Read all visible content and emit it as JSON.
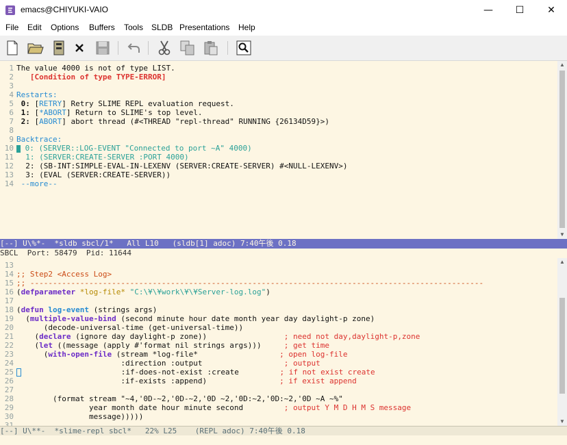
{
  "window": {
    "title": "emacs@CHIYUKI-VAIO"
  },
  "menu": [
    "File",
    "Edit",
    "Options",
    "Buffers",
    "Tools",
    "SLDB",
    "Presentations",
    "Help"
  ],
  "toolbar": {
    "icons": [
      "new-file-icon",
      "open-folder-icon",
      "dired-icon",
      "close-buffer-icon",
      "save-icon",
      "undo-icon",
      "cut-icon",
      "copy-icon",
      "paste-icon",
      "search-icon"
    ]
  },
  "sldb": {
    "lines": [
      {
        "n": "1",
        "segs": [
          [
            "",
            "The value 4000 is not of type LIST."
          ]
        ]
      },
      {
        "n": "2",
        "segs": [
          [
            "err",
            "   [Condition of type TYPE-ERROR]"
          ]
        ]
      },
      {
        "n": "3",
        "segs": [
          [
            "",
            ""
          ]
        ]
      },
      {
        "n": "4",
        "segs": [
          [
            "lbl",
            "Restarts:"
          ]
        ]
      },
      {
        "n": "5",
        "segs": [
          [
            "",
            ""
          ],
          [
            "kw0",
            " 0: "
          ],
          [
            "",
            "["
          ],
          [
            "lbl",
            "RETRY"
          ],
          [
            "",
            "] Retry SLIME REPL evaluation request."
          ]
        ]
      },
      {
        "n": "6",
        "segs": [
          [
            "kw0",
            " 1: "
          ],
          [
            "",
            "["
          ],
          [
            "lbl",
            "*ABORT"
          ],
          [
            "",
            "] Return to SLIME's top level."
          ]
        ]
      },
      {
        "n": "7",
        "segs": [
          [
            "kw0",
            " 2: "
          ],
          [
            "",
            "["
          ],
          [
            "lbl",
            "ABORT"
          ],
          [
            "",
            "] abort thread (#<THREAD \"repl-thread\" RUNNING {26134D59}>)"
          ]
        ]
      },
      {
        "n": "8",
        "segs": [
          [
            "",
            ""
          ]
        ]
      },
      {
        "n": "9",
        "segs": [
          [
            "lbl",
            "Backtrace:"
          ]
        ]
      },
      {
        "n": "10",
        "segs": [
          [
            "cursor",
            ""
          ],
          [
            "grn",
            " 0: (SERVER::LOG-EVENT \"Connected to port ~A\" 4000)"
          ]
        ]
      },
      {
        "n": "11",
        "segs": [
          [
            "grn",
            "  1: (SERVER:CREATE-SERVER :PORT 4000)"
          ]
        ]
      },
      {
        "n": "12",
        "segs": [
          [
            "",
            "  2: (SB-INT:SIMPLE-EVAL-IN-LEXENV (SERVER:CREATE-SERVER) #<NULL-LEXENV>)"
          ]
        ]
      },
      {
        "n": "13",
        "segs": [
          [
            "",
            "  3: (EVAL (SERVER:CREATE-SERVER))"
          ]
        ]
      },
      {
        "n": "14",
        "segs": [
          [
            "lbl",
            " --more--"
          ]
        ]
      }
    ],
    "modeline": "[--] U\\%*-  *sldb sbcl/1*   All L10   (sldb[1] adoc) 7:40午後 0.18"
  },
  "echo": "SBCL  Port: 58479  Pid: 11644",
  "repl": {
    "lines": [
      {
        "n": "13",
        "segs": [
          [
            "",
            ""
          ]
        ]
      },
      {
        "n": "14",
        "segs": [
          [
            "cmt",
            ";; Step2 <Access Log>"
          ]
        ]
      },
      {
        "n": "15",
        "segs": [
          [
            "cmt",
            ";; ----------------------------------------------------------------------------------------------------"
          ]
        ]
      },
      {
        "n": "16",
        "segs": [
          [
            "",
            "("
          ],
          [
            "kw2",
            "defparameter"
          ],
          [
            "",
            ""
          ],
          [
            "var",
            " *log-file*"
          ],
          [
            "",
            " "
          ],
          [
            "str",
            "\"C:\\¥\\¥work\\¥\\¥Server-log.log\""
          ],
          [
            "",
            ")"
          ]
        ]
      },
      {
        "n": "17",
        "segs": [
          [
            "",
            ""
          ]
        ]
      },
      {
        "n": "18",
        "segs": [
          [
            "",
            "("
          ],
          [
            "kw2",
            "defun"
          ],
          [
            "",
            " "
          ],
          [
            "fn",
            "log-event"
          ],
          [
            "",
            " (strings args)"
          ]
        ]
      },
      {
        "n": "19",
        "segs": [
          [
            "",
            "  ("
          ],
          [
            "kw2",
            "multiple-value-bind"
          ],
          [
            "",
            " (second minute hour date month year day daylight-p zone)"
          ]
        ]
      },
      {
        "n": "20",
        "segs": [
          [
            "",
            "      (decode-universal-time (get-universal-time))"
          ]
        ]
      },
      {
        "n": "21",
        "segs": [
          [
            "",
            "    ("
          ],
          [
            "kw2",
            "declare"
          ],
          [
            "",
            " (ignore day daylight-p zone))                 "
          ],
          [
            "cmt2",
            "; need not day,daylight-p,zone"
          ]
        ]
      },
      {
        "n": "22",
        "segs": [
          [
            "",
            "    ("
          ],
          [
            "kw2",
            "let"
          ],
          [
            "",
            " ((message (apply #'format nil strings args)))     "
          ],
          [
            "cmt2",
            "; get time"
          ]
        ]
      },
      {
        "n": "23",
        "segs": [
          [
            "",
            "      ("
          ],
          [
            "kw2",
            "with-open-file"
          ],
          [
            "",
            " (stream *log-file*                  "
          ],
          [
            "cmt2",
            "; open log-file"
          ]
        ]
      },
      {
        "n": "24",
        "segs": [
          [
            "",
            "                       :direction :output                  "
          ],
          [
            "cmt2",
            "; output"
          ]
        ]
      },
      {
        "n": "25",
        "segs": [
          [
            "hollow",
            ""
          ],
          [
            "",
            "                      :if-does-not-exist :create         "
          ],
          [
            "cmt2",
            "; if not exist create"
          ]
        ]
      },
      {
        "n": "26",
        "segs": [
          [
            "",
            "                       :if-exists :append)                "
          ],
          [
            "cmt2",
            "; if exist append"
          ]
        ]
      },
      {
        "n": "27",
        "segs": [
          [
            "",
            ""
          ]
        ]
      },
      {
        "n": "28",
        "segs": [
          [
            "",
            "        (format stream \"~4,'0D-~2,'0D-~2,'0D ~2,'0D:~2,'0D:~2,'0D ~A ~%\""
          ]
        ]
      },
      {
        "n": "29",
        "segs": [
          [
            "",
            "                year month date hour minute second         "
          ],
          [
            "cmt2",
            "; output Y M D H M S message"
          ]
        ]
      },
      {
        "n": "30",
        "segs": [
          [
            "",
            "                message)))))"
          ]
        ]
      },
      {
        "n": "31",
        "segs": [
          [
            "",
            ""
          ]
        ]
      }
    ],
    "modeline": "[--] U\\**-  *slime-repl sbcl*   22% L25    (REPL adoc) 7:40午後 0.18"
  }
}
